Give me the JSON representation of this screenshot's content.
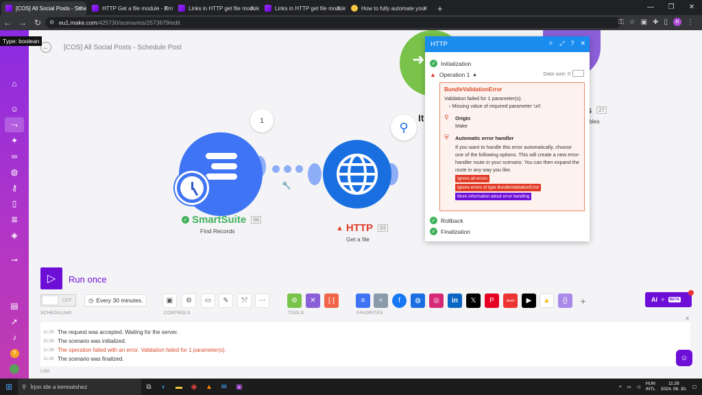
{
  "browser": {
    "tabs": [
      {
        "label": "[COS] All Social Posts - Schedule",
        "active": true
      },
      {
        "label": "HTTP Get a file module - Error:"
      },
      {
        "label": "Links in HTTP get file module er"
      },
      {
        "label": "Links in HTTP get file module er"
      },
      {
        "label": "How to fully automate your"
      }
    ],
    "url_host": "eu1.make.com",
    "url_path": "/425730/scenarios/2573679/edit"
  },
  "tooltip": "Type: boolean",
  "scenario_title": "[COS] All Social Posts - Schedule Post",
  "modules": {
    "smartsuite": {
      "name": "SmartSuite",
      "count": "66",
      "action": "Find Records",
      "bubble": "1",
      "color": "#3f74f5"
    },
    "http": {
      "name": "HTTP",
      "count": "93",
      "action": "Get a file",
      "color": "#1a6fe0"
    },
    "iterator": {
      "label_partial": "It",
      "color": "#79c34a"
    },
    "variables": {
      "label_partial": "s",
      "count": "27",
      "action_partial": "ariables",
      "color": "#8a5fd8"
    }
  },
  "panel": {
    "title": "HTTP",
    "initialization": "Initialization",
    "operation": "Operation 1",
    "data_size_label": "Data size: 0",
    "error_title": "BundleValidationError",
    "error_msg": "Validation failed for 1 parameter(s).",
    "error_detail": "Missing value of required parameter 'url'.",
    "origin_label": "Origin",
    "origin_value": "Make",
    "handler_label": "Automatic error handler",
    "handler_text": "If you want to handle this error automatically, choose one of the following options. This will create a new error-handler route in your scenario. You can then expand the route in any way you like.",
    "btn_ignore_all": "Ignore all errors",
    "btn_ignore_type": "Ignore errors of type BundleValidationError",
    "btn_more_info": "More information about error handling",
    "rollback": "Rollback",
    "finalization": "Finalization"
  },
  "run_once": "Run once",
  "toolbar": {
    "toggle_state": "OFF",
    "schedule": "Every 30 minutes.",
    "scheduling_label": "SCHEDULING",
    "controls_label": "CONTROLS",
    "tools_label": "TOOLS",
    "favorites_label": "FAVORITES",
    "ai_label": "AI",
    "beta_label": "BETA"
  },
  "log": {
    "label": "LOG",
    "entries": [
      {
        "time": "11:28",
        "text": "The request was accepted. Waiting for the server.",
        "type": "info"
      },
      {
        "time": "11:28",
        "text": "The scenario was initialized.",
        "type": "info"
      },
      {
        "time": "11:28",
        "text": "The operation failed with an error. Validation failed for 1 parameter(s).",
        "type": "error"
      },
      {
        "time": "11:28",
        "text": "The scenario was finalized.",
        "type": "info"
      }
    ]
  },
  "taskbar": {
    "search_placeholder": "Írjon ide a kereséshez",
    "lang": "HUN",
    "layout": "INTL",
    "time": "11:28",
    "date": "2024. 06. 30."
  }
}
